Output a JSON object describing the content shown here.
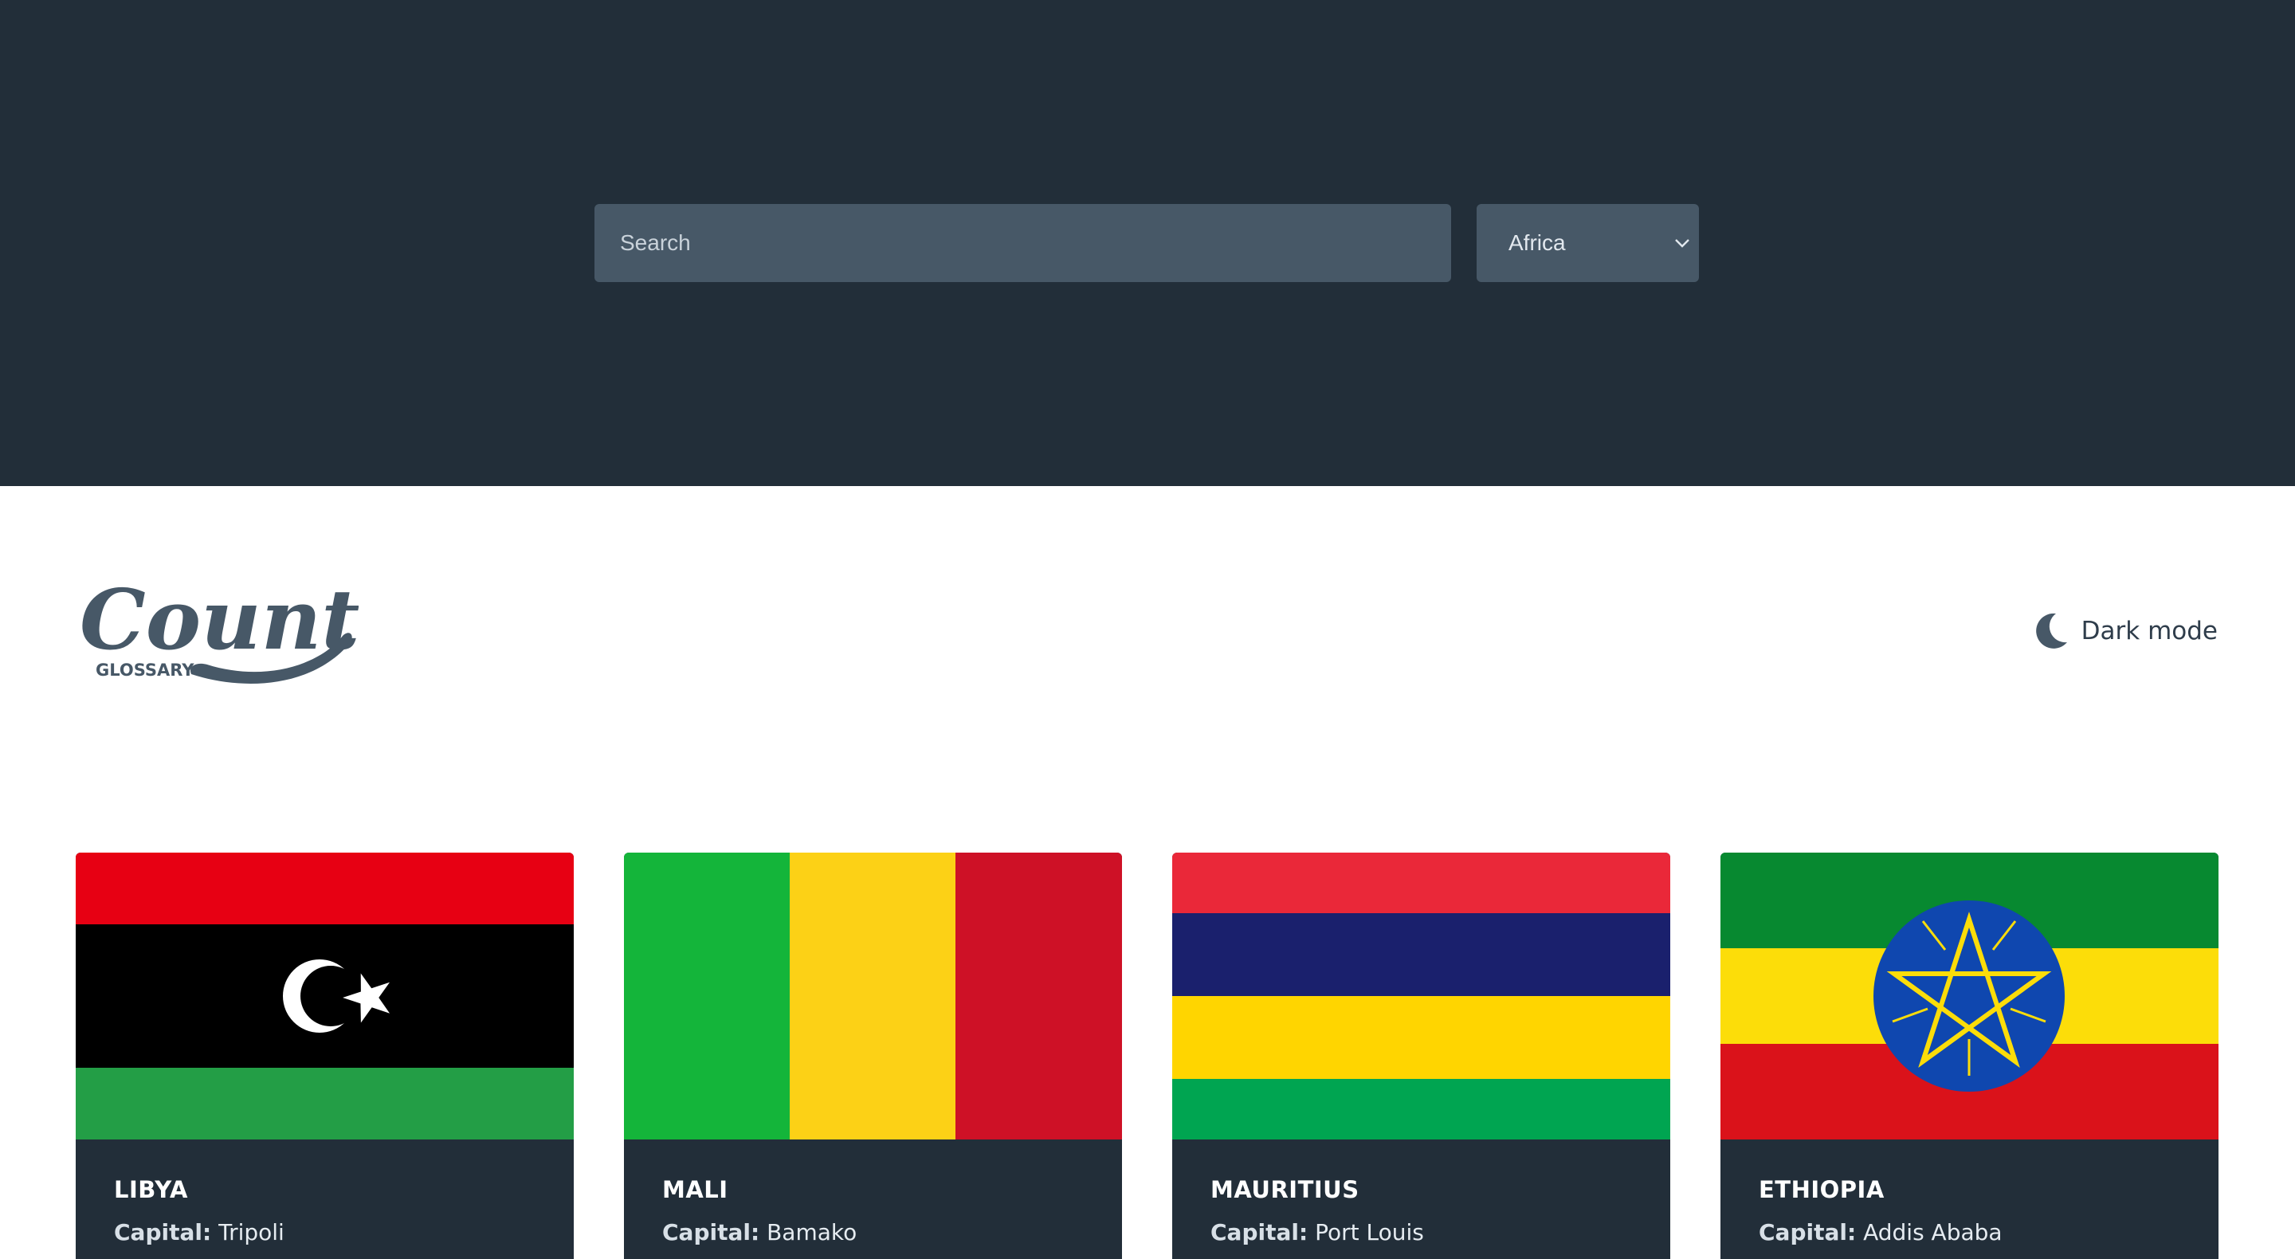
{
  "search": {
    "placeholder": "Search"
  },
  "region_filter": {
    "selected": "Africa"
  },
  "header": {
    "logo_text": "Country",
    "logo_sub": "GLOSSARY",
    "dark_mode_label": "Dark mode"
  },
  "colors": {
    "dark_bg": "#222e39",
    "input_bg": "#475867",
    "text_dark": "#2f3d4b"
  },
  "countries": [
    {
      "name": "LIBYA",
      "capital_label": "Capital:",
      "capital": "Tripoli"
    },
    {
      "name": "MALI",
      "capital_label": "Capital:",
      "capital": "Bamako"
    },
    {
      "name": "MAURITIUS",
      "capital_label": "Capital:",
      "capital": "Port Louis"
    },
    {
      "name": "ETHIOPIA",
      "capital_label": "Capital:",
      "capital": "Addis Ababa"
    }
  ]
}
